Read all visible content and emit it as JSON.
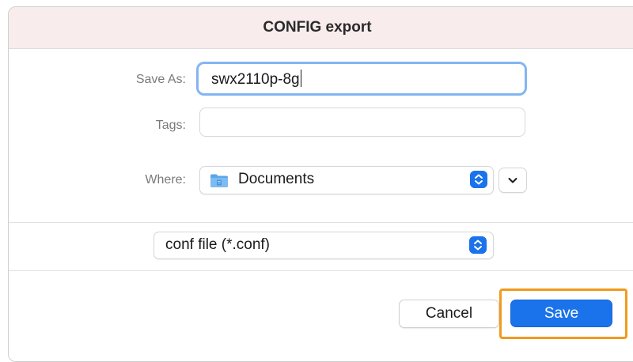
{
  "dialog": {
    "title": "CONFIG export",
    "save_as_label": "Save As:",
    "save_as_value": "swx2110p-8g",
    "tags_label": "Tags:",
    "tags_value": "",
    "where_label": "Where:",
    "where_value": "Documents",
    "format_value": "conf file (*.conf)",
    "cancel_label": "Cancel",
    "save_label": "Save"
  },
  "icons": {
    "folder": "folder-icon",
    "stepper": "up-down-stepper-icon",
    "chevron": "chevron-down-icon"
  },
  "colors": {
    "accent": "#1a73ea",
    "titlebar": "#f8ecec",
    "highlight": "#f19a1b",
    "focus_ring": "#84b5f3"
  }
}
